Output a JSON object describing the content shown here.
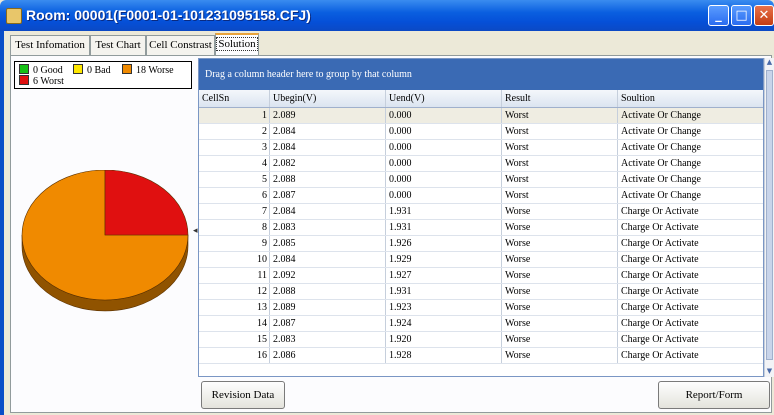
{
  "window": {
    "title": "Room: 00001(F0001-01-101231095158.CFJ)"
  },
  "window_controls": {
    "minimize": "_",
    "maximize": "□",
    "close": "✕"
  },
  "tabs": [
    {
      "label": "Test Infomation"
    },
    {
      "label": "Test Chart"
    },
    {
      "label": "Cell Constrast"
    },
    {
      "label": "Solution",
      "active": true
    }
  ],
  "legend": [
    {
      "label": "0 Good",
      "color": "#16c016"
    },
    {
      "label": "0 Bad",
      "color": "#ffe800"
    },
    {
      "label": "18 Worse",
      "color": "#f08a00"
    },
    {
      "label": "6 Worst",
      "color": "#e01010"
    }
  ],
  "chart_data": {
    "type": "pie",
    "categories": [
      "Good",
      "Bad",
      "Worse",
      "Worst"
    ],
    "values": [
      0,
      0,
      18,
      6
    ],
    "colors": [
      "#16c016",
      "#ffe800",
      "#f08a00",
      "#e01010"
    ]
  },
  "grid": {
    "group_hint": "Drag a column header here to group by that column",
    "columns": [
      "CellSn",
      "Ubegin(V)",
      "Uend(V)",
      "Result",
      "Soultion"
    ],
    "rows": [
      [
        "1",
        "2.089",
        "0.000",
        "Worst",
        "Activate Or Change"
      ],
      [
        "2",
        "2.084",
        "0.000",
        "Worst",
        "Activate Or Change"
      ],
      [
        "3",
        "2.084",
        "0.000",
        "Worst",
        "Activate Or Change"
      ],
      [
        "4",
        "2.082",
        "0.000",
        "Worst",
        "Activate Or Change"
      ],
      [
        "5",
        "2.088",
        "0.000",
        "Worst",
        "Activate Or Change"
      ],
      [
        "6",
        "2.087",
        "0.000",
        "Worst",
        "Activate Or Change"
      ],
      [
        "7",
        "2.084",
        "1.931",
        "Worse",
        "Charge Or Activate"
      ],
      [
        "8",
        "2.083",
        "1.931",
        "Worse",
        "Charge Or Activate"
      ],
      [
        "9",
        "2.085",
        "1.926",
        "Worse",
        "Charge Or Activate"
      ],
      [
        "10",
        "2.084",
        "1.929",
        "Worse",
        "Charge Or Activate"
      ],
      [
        "11",
        "2.092",
        "1.927",
        "Worse",
        "Charge Or Activate"
      ],
      [
        "12",
        "2.088",
        "1.931",
        "Worse",
        "Charge Or Activate"
      ],
      [
        "13",
        "2.089",
        "1.923",
        "Worse",
        "Charge Or Activate"
      ],
      [
        "14",
        "2.087",
        "1.924",
        "Worse",
        "Charge Or Activate"
      ],
      [
        "15",
        "2.083",
        "1.920",
        "Worse",
        "Charge Or Activate"
      ],
      [
        "16",
        "2.086",
        "1.928",
        "Worse",
        "Charge Or Activate"
      ]
    ]
  },
  "buttons": {
    "revision": "Revision Data",
    "report": "Report/Form"
  },
  "icons": {
    "splitter": "◂",
    "scroll_up": "▲",
    "scroll_down": "▼"
  }
}
